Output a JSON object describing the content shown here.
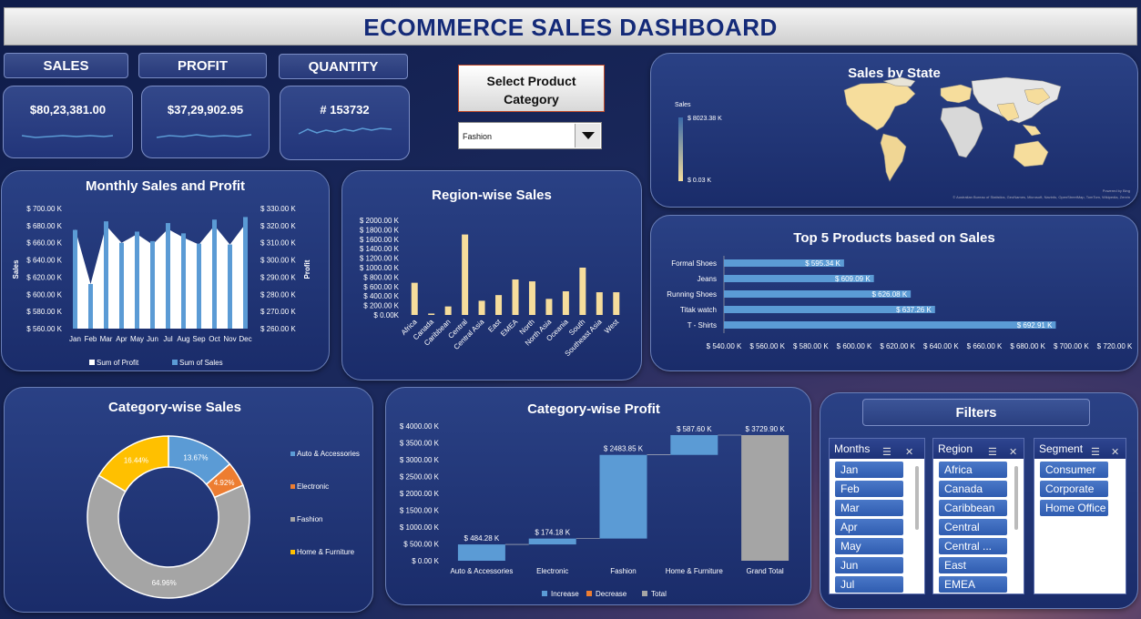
{
  "title": "ECOMMERCE SALES DASHBOARD",
  "kpis": [
    {
      "label": "SALES",
      "value": "$80,23,381.00"
    },
    {
      "label": "PROFIT",
      "value": "$37,29,902.95"
    },
    {
      "label": "QUANTITY",
      "value": "# 153732"
    }
  ],
  "select_category": {
    "label": "Select Product Category",
    "value": "Fashion"
  },
  "map": {
    "title": "Sales by State",
    "legend_title": "Sales",
    "max_label": "$ 8023.38 K",
    "min_label": "$ 0.03 K",
    "credit_top": "Powered by Bing",
    "credit": "© Australian Bureau of Statistics, GeoNames, Microsoft, Navinfo, OpenStreetMap, TomTom, Wikipedia, Zenrin"
  },
  "monthly": {
    "title": "Monthly Sales and Profit",
    "ylabel_left": "Sales",
    "ylabel_right": "Profit",
    "left_ticks": [
      "$ 700.00 K",
      "$ 680.00 K",
      "$ 660.00 K",
      "$ 640.00 K",
      "$ 620.00 K",
      "$ 600.00 K",
      "$ 580.00 K",
      "$ 560.00 K"
    ],
    "right_ticks": [
      "$ 330.00 K",
      "$ 320.00 K",
      "$ 310.00 K",
      "$ 300.00 K",
      "$ 290.00 K",
      "$ 280.00 K",
      "$ 270.00 K",
      "$ 260.00 K"
    ],
    "months": [
      "Jan",
      "Feb",
      "Mar",
      "Apr",
      "May",
      "Jun",
      "Jul",
      "Aug",
      "Sep",
      "Oct",
      "Nov",
      "Dec"
    ],
    "legend_profit": "Sum of Profit",
    "legend_sales": "Sum of Sales"
  },
  "region": {
    "title": "Region-wise Sales",
    "ticks": [
      "$ 2000.00 K",
      "$ 1800.00 K",
      "$ 1600.00 K",
      "$ 1400.00 K",
      "$ 1200.00 K",
      "$ 1000.00 K",
      "$ 800.00 K",
      "$ 600.00 K",
      "$ 400.00 K",
      "$ 200.00 K",
      "$ 0.00K"
    ]
  },
  "top5": {
    "title": "Top 5 Products based on Sales",
    "labels": [
      "Formal Shoes",
      "Jeans",
      "Running Shoes",
      "Titak watch",
      "T - Shirts"
    ],
    "value_labels": [
      "$ 595.34 K",
      "$ 609.09 K",
      "$ 626.08 K",
      "$ 637.26 K",
      "$ 692.91 K"
    ],
    "ticks": [
      "$ 540.00 K",
      "$ 560.00 K",
      "$ 580.00 K",
      "$ 600.00 K",
      "$ 620.00 K",
      "$ 640.00 K",
      "$ 660.00 K",
      "$ 680.00 K",
      "$ 700.00 K",
      "$ 720.00 K"
    ]
  },
  "category_sales": {
    "title": "Category-wise Sales",
    "legend": [
      "Auto & Accessories",
      "Electronic",
      "Fashion",
      "Home & Furniture"
    ],
    "pct_labels": [
      "13.67%",
      "4.92%",
      "64.96%",
      "16.44%"
    ]
  },
  "category_profit": {
    "title": "Category-wise Profit",
    "ticks": [
      "$ 4000.00 K",
      "$ 3500.00 K",
      "$ 3000.00 K",
      "$ 2500.00 K",
      "$ 2000.00 K",
      "$ 1500.00 K",
      "$ 1000.00 K",
      "$ 500.00 K",
      "$ 0.00 K"
    ],
    "categories": [
      "Auto & Accessories",
      "Electronic",
      "Fashion",
      "Home & Furniture",
      "Grand Total"
    ],
    "value_labels": [
      "$ 484.28 K",
      "$ 174.18 K",
      "$ 2483.85 K",
      "$ 587.60 K",
      "$ 3729.90 K"
    ],
    "legend": [
      "Increase",
      "Decrease",
      "Total"
    ]
  },
  "filters": {
    "title": "Filters",
    "months": {
      "header": "Months",
      "items": [
        "Jan",
        "Feb",
        "Mar",
        "Apr",
        "May",
        "Jun",
        "Jul"
      ]
    },
    "region": {
      "header": "Region",
      "items": [
        "Africa",
        "Canada",
        "Caribbean",
        "Central",
        "Central ...",
        "East",
        "EMEA"
      ]
    },
    "segment": {
      "header": "Segment",
      "items": [
        "Consumer",
        "Corporate",
        "Home Office"
      ]
    }
  },
  "colors": {
    "blue": "#5b9bd5",
    "sand": "#f6dd9c",
    "orange": "#ed7d31",
    "gray": "#a5a5a5",
    "gold": "#ffc000",
    "white": "#ffffff"
  },
  "chart_data": [
    {
      "type": "bar",
      "title": "Monthly Sales and Profit",
      "categories": [
        "Jan",
        "Feb",
        "Mar",
        "Apr",
        "May",
        "Jun",
        "Jul",
        "Aug",
        "Sep",
        "Oct",
        "Nov",
        "Dec"
      ],
      "series": [
        {
          "name": "Sum of Sales",
          "axis": "left",
          "values": [
            675,
            612,
            685,
            660,
            673,
            662,
            683,
            671,
            659,
            687,
            658,
            690
          ]
        },
        {
          "name": "Sum of Profit",
          "axis": "right",
          "type": "area",
          "values": [
            318,
            286,
            320,
            310,
            315,
            309,
            318,
            313,
            309,
            320,
            309,
            321
          ]
        }
      ],
      "ylim_left": [
        560,
        700
      ],
      "ylim_right": [
        260,
        330
      ],
      "units": "K"
    },
    {
      "type": "bar",
      "title": "Region-wise Sales",
      "categories": [
        "Africa",
        "Canada",
        "Caribbean",
        "Central",
        "Central Asia",
        "East",
        "EMEA",
        "North",
        "North Asia",
        "Oceania",
        "South",
        "Southeast Asia",
        "West"
      ],
      "values": [
        680,
        30,
        180,
        1700,
        300,
        420,
        750,
        710,
        340,
        500,
        1000,
        480,
        480
      ],
      "ylim": [
        0,
        2000
      ],
      "units": "K"
    },
    {
      "type": "bar",
      "orientation": "horizontal",
      "title": "Top 5 Products based on Sales",
      "categories": [
        "Formal Shoes",
        "Jeans",
        "Running Shoes",
        "Titak watch",
        "T - Shirts"
      ],
      "values": [
        595.34,
        609.09,
        626.08,
        637.26,
        692.91
      ],
      "xlim": [
        540,
        720
      ],
      "units": "K"
    },
    {
      "type": "pie",
      "title": "Category-wise Sales",
      "categories": [
        "Auto & Accessories",
        "Electronic",
        "Fashion",
        "Home & Furniture"
      ],
      "values": [
        13.67,
        4.92,
        64.96,
        16.44
      ]
    },
    {
      "type": "bar",
      "subtype": "waterfall",
      "title": "Category-wise Profit",
      "categories": [
        "Auto & Accessories",
        "Electronic",
        "Fashion",
        "Home & Furniture",
        "Grand Total"
      ],
      "values": [
        484.28,
        174.18,
        2483.85,
        587.6,
        3729.9
      ],
      "kinds": [
        "increase",
        "increase",
        "increase",
        "increase",
        "total"
      ],
      "ylim": [
        0,
        4000
      ],
      "units": "K"
    }
  ]
}
